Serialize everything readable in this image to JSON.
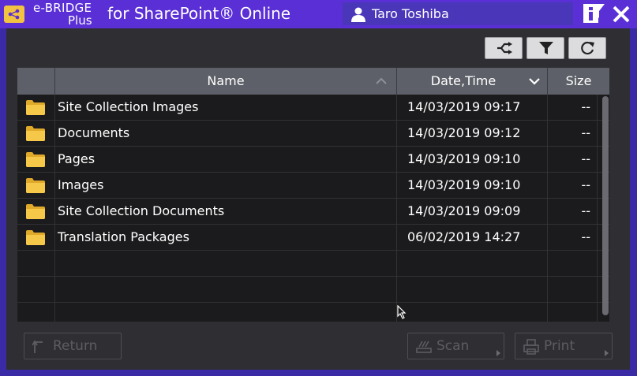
{
  "app": {
    "brand_line1": "e-BRIDGE",
    "brand_line2": "Plus",
    "title": "for SharePoint® Online",
    "user_name": "Taro Toshiba"
  },
  "table": {
    "headers": {
      "name": "Name",
      "date": "Date,Time",
      "size": "Size"
    },
    "rows": [
      {
        "name": "Site Collection Images",
        "date": "14/03/2019 09:17",
        "size": "--"
      },
      {
        "name": "Documents",
        "date": "14/03/2019 09:12",
        "size": "--"
      },
      {
        "name": "Pages",
        "date": "14/03/2019 09:10",
        "size": "--"
      },
      {
        "name": "Images",
        "date": "14/03/2019 09:10",
        "size": "--"
      },
      {
        "name": "Site Collection Documents",
        "date": "14/03/2019 09:09",
        "size": "--"
      },
      {
        "name": "Translation Packages",
        "date": "06/02/2019 14:27",
        "size": "--"
      }
    ]
  },
  "buttons": {
    "return": "Return",
    "scan": "Scan",
    "print": "Print"
  },
  "icons": {
    "app": "share-icon",
    "user": "user-icon",
    "info": "info-icon",
    "close": "close-icon",
    "switch": "switch-site-icon",
    "filter": "filter-icon",
    "refresh": "refresh-icon",
    "folder": "folder-icon"
  },
  "colors": {
    "titlebar": "#5a2fd6",
    "panel": "#2f2f33",
    "header": "#5d6068",
    "folder": "#f5c84a"
  }
}
